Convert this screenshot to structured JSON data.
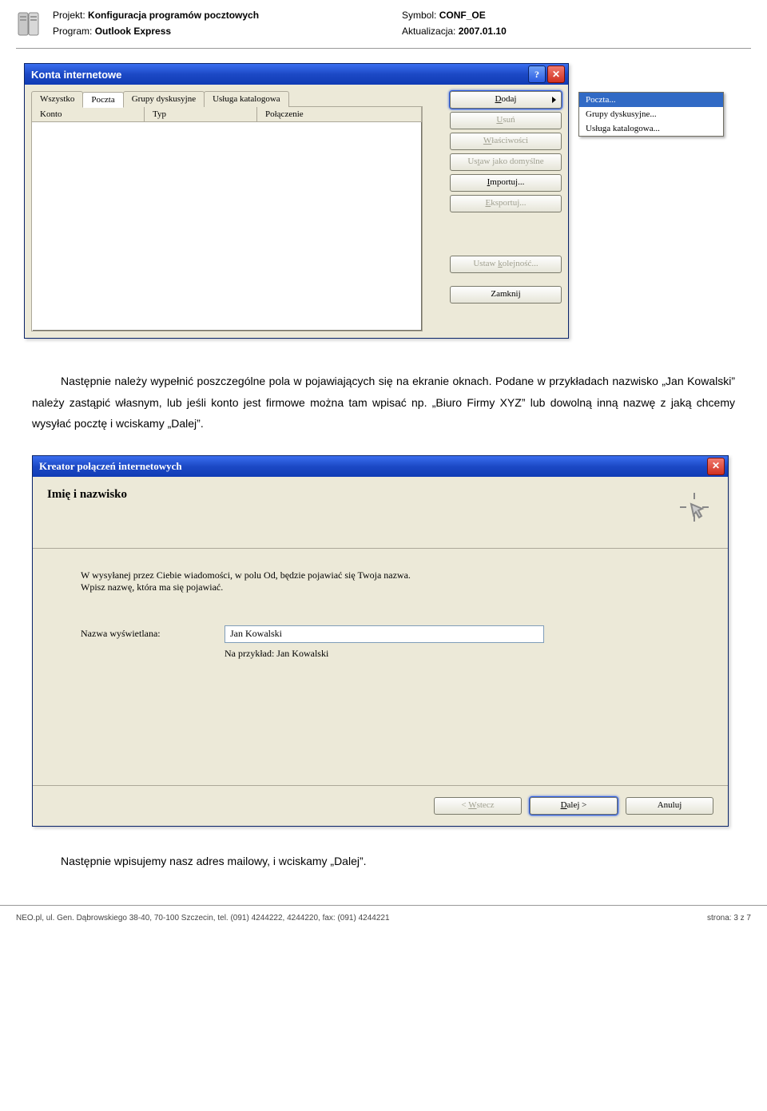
{
  "doc": {
    "projekt_label": "Projekt:",
    "projekt_value": "Konfiguracja programów pocztowych",
    "symbol_label": "Symbol:",
    "symbol_value": "CONF_OE",
    "program_label": "Program:",
    "program_value": "Outlook Express",
    "aktual_label": "Aktualizacja:",
    "aktual_value": "2007.01.10"
  },
  "dialog1": {
    "title": "Konta internetowe",
    "tabs": [
      "Wszystko",
      "Poczta",
      "Grupy dyskusyjne",
      "Usługa katalogowa"
    ],
    "active_tab": 1,
    "columns": [
      "Konto",
      "Typ",
      "Połączenie"
    ],
    "buttons": {
      "dodaj": "Dodaj",
      "usun": "Usuń",
      "wlasc": "Właściwości",
      "domyslne": "Ustaw jako domyślne",
      "importuj": "Importuj...",
      "eksportuj": "Eksportuj...",
      "kolejnosc": "Ustaw kolejność...",
      "zamknij": "Zamknij"
    },
    "popup": [
      "Poczta...",
      "Grupy dyskusyjne...",
      "Usługa katalogowa..."
    ]
  },
  "paragraph1": "Następnie należy wypełnić poszczególne pola w pojawiających się na ekranie oknach. Podane w przykładach nazwisko „Jan Kowalski” należy zastąpić własnym, lub jeśli konto jest firmowe można tam wpisać np. „Biuro Firmy XYZ” lub dowolną inną nazwę z jaką chcemy wysyłać pocztę i wciskamy „Dalej”.",
  "wizard": {
    "title": "Kreator połączeń internetowych",
    "heading": "Imię i nazwisko",
    "desc1": "W wysyłanej przez Ciebie wiadomości, w polu Od, będzie pojawiać się Twoja nazwa.",
    "desc2": "Wpisz nazwę, która ma się pojawiać.",
    "label_display": "Nazwa wyświetlana:",
    "input_value": "Jan Kowalski",
    "example": "Na przykład: Jan Kowalski",
    "btn_back": "< Wstecz",
    "btn_next": "Dalej >",
    "btn_cancel": "Anuluj"
  },
  "paragraph2": "Następnie wpisujemy nasz adres mailowy, i wciskamy „Dalej”.",
  "footer": {
    "left": "NEO.pl, ul. Gen. Dąbrowskiego 38-40, 70-100 Szczecin, tel. (091) 4244222, 4244220, fax: (091) 4244221",
    "right": "strona: 3 z 7"
  }
}
